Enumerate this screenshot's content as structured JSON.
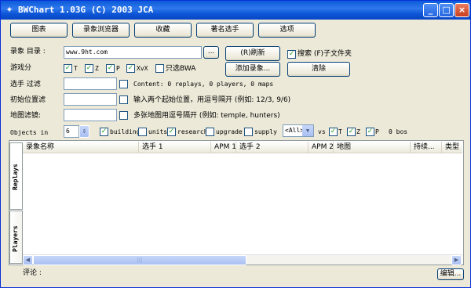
{
  "window": {
    "title": "BWChart 1.03G (C) 2003 JCA",
    "app_icon": "chart-app-icon"
  },
  "toolbar": [
    "图表",
    "录象浏览器",
    "收藏",
    "著名选手",
    "选项"
  ],
  "replay_dir": {
    "label": "录象 目录 :",
    "value": "www.9ht.com",
    "browse": "...",
    "refresh": "(R)刷新",
    "search_label": "搜索 (F)子文件夹",
    "search_checked": true
  },
  "gamemode": {
    "label": "游戏分",
    "options": [
      {
        "label": "T",
        "checked": true
      },
      {
        "label": "Z",
        "checked": true
      },
      {
        "label": "P",
        "checked": true
      },
      {
        "label": "XvX",
        "checked": true
      },
      {
        "label": "只选BWA",
        "checked": false
      }
    ],
    "add_button": "添加录象...",
    "clear_button": "清除"
  },
  "player_filter": {
    "label": "选手 过滤",
    "value": "",
    "checked": false,
    "info": "Content: 0 replays, 0 players, 0 maps"
  },
  "start_filter": {
    "label": "初始位置滤",
    "value": "",
    "checked": false,
    "hint": "输入两个起始位置，用逗号隔开 (例如: 12/3, 9/6)"
  },
  "map_filter": {
    "label": "地图滤镜:",
    "value": "",
    "checked": false,
    "hint": "多张地图用逗号隔开 (例如: temple, hunters)"
  },
  "objects": {
    "label": "Objects in",
    "value": "6",
    "options": [
      {
        "label": "building",
        "checked": true
      },
      {
        "label": "units",
        "checked": false
      },
      {
        "label": "research",
        "checked": true
      },
      {
        "label": "upgrade",
        "checked": false
      },
      {
        "label": "supply",
        "checked": false
      }
    ],
    "select_value": "<All>",
    "vs_label": "vs",
    "races": [
      {
        "label": "T",
        "checked": true
      },
      {
        "label": "Z",
        "checked": true
      },
      {
        "label": "P",
        "checked": true
      }
    ],
    "bos_label": "0 bos"
  },
  "tabs": [
    "Replays",
    "Players"
  ],
  "columns": [
    "录象名称",
    "选手 1",
    "APM 1",
    "选手 2",
    "APM 2",
    "地图",
    "持续...",
    "类型"
  ],
  "footer": {
    "comment_label": "评论 :",
    "edit_button": "编辑..."
  }
}
